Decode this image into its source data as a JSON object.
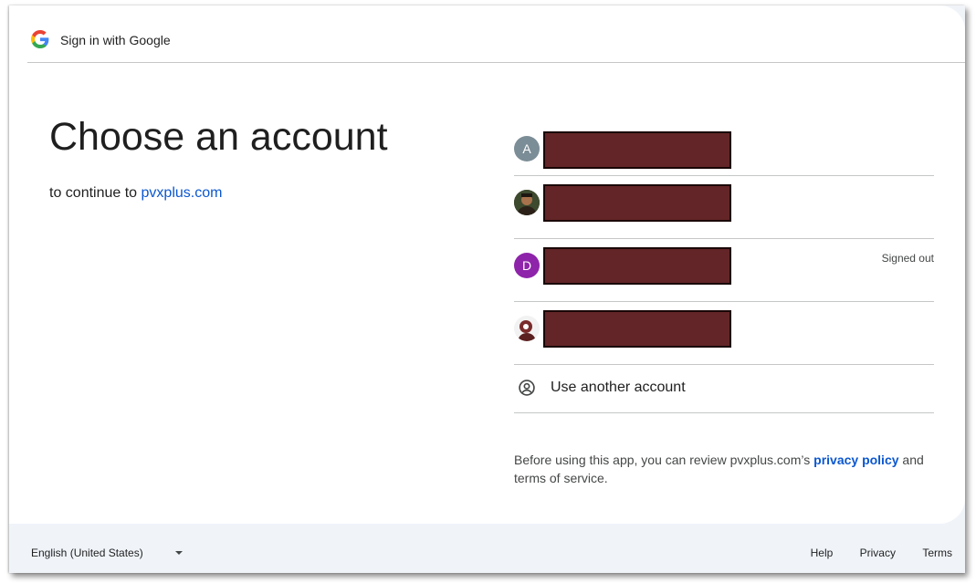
{
  "header": {
    "title": "Sign in with Google",
    "logo_icon": "google-g-icon"
  },
  "main": {
    "title": "Choose an account",
    "subtitle_prefix": "to continue to",
    "subtitle_link": "pvxplus.com"
  },
  "accounts": [
    {
      "avatar_letter": "A",
      "avatar_color": "#7b8d96",
      "status": ""
    },
    {
      "avatar_letter": "",
      "avatar_color": "#5a4a3a",
      "avatar_kind": "photo",
      "status": ""
    },
    {
      "avatar_letter": "D",
      "avatar_color": "#8e24aa",
      "status": "Signed out"
    },
    {
      "avatar_letter": "",
      "avatar_color": "#7a2b2b",
      "avatar_kind": "photo",
      "status": ""
    }
  ],
  "use_another": {
    "label": "Use another account",
    "icon": "account-circle-icon"
  },
  "disclaimer": {
    "prefix": "Before using this app, you can review pvxplus.com’s",
    "link": "privacy policy",
    "suffix": "and terms of service."
  },
  "footer": {
    "language": "English (United States)",
    "links": [
      "Help",
      "Privacy",
      "Terms"
    ]
  },
  "colors": {
    "link": "#0b57d0",
    "redaction": "#632527",
    "footer_bg": "#f0f4f9"
  }
}
